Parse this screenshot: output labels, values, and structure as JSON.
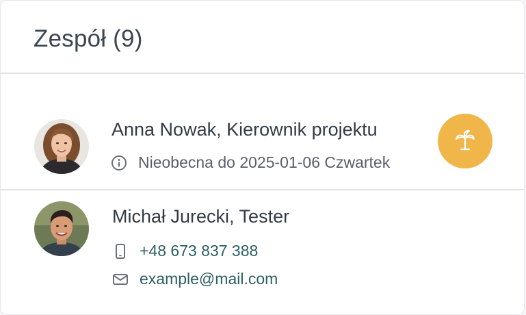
{
  "team": {
    "title": "Zespół (9)"
  },
  "members": [
    {
      "name": "Anna Nowak, Kierownik projektu",
      "avatar": "avatar-photo-woman",
      "status_icon": "info-icon",
      "status_text": "Nieobecna do 2025-01-06 Czwartek",
      "badge_icon": "palm-tree-icon",
      "badge_color": "#f0b64a"
    },
    {
      "name": "Michał Jurecki, Tester",
      "avatar": "avatar-photo-man",
      "phone_icon": "mobile-phone-icon",
      "phone": "+48 673 837 388",
      "email_icon": "envelope-icon",
      "email": "example@mail.com",
      "link_color": "#2d5f63"
    }
  ]
}
